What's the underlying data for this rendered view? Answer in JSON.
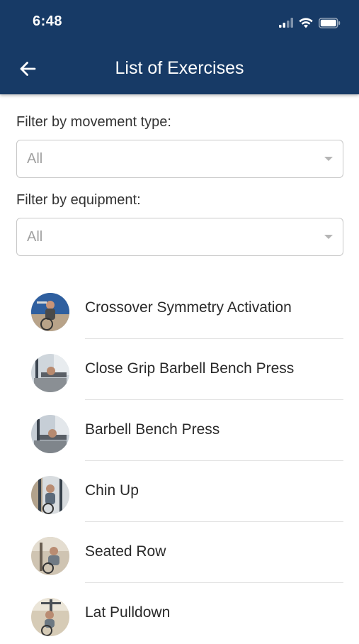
{
  "status_bar": {
    "time": "6:48",
    "icons": [
      "cellular-signal-icon",
      "wifi-icon",
      "battery-icon"
    ]
  },
  "header": {
    "back_icon": "arrow-left-icon",
    "title": "List of Exercises",
    "background_color": "#173a66"
  },
  "filters": {
    "movement": {
      "label": "Filter by movement type:",
      "value": "All"
    },
    "equipment": {
      "label": "Filter by equipment:",
      "value": "All"
    }
  },
  "exercises": [
    {
      "name": "Crossover Symmetry Activation"
    },
    {
      "name": "Close Grip Barbell Bench Press"
    },
    {
      "name": "Barbell Bench Press"
    },
    {
      "name": "Chin Up"
    },
    {
      "name": "Seated Row"
    },
    {
      "name": "Lat Pulldown"
    }
  ]
}
